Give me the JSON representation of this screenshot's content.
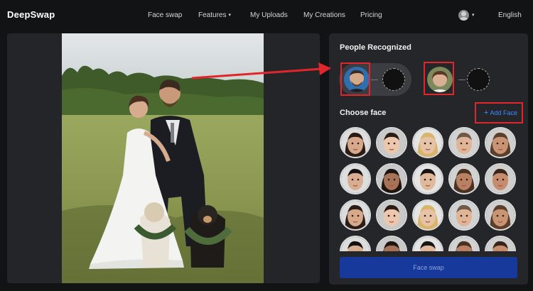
{
  "nav": {
    "logo": "DeepSwap",
    "items": [
      {
        "label": "Face swap"
      },
      {
        "label": "Features",
        "caret": "▾"
      },
      {
        "label": "My Uploads"
      },
      {
        "label": "My Creations"
      },
      {
        "label": "Pricing"
      }
    ],
    "language": "English",
    "language_caret": "▾",
    "user_caret": "▾"
  },
  "panel": {
    "people_title": "People Recognized",
    "choose_title": "Choose face",
    "add_face_icon": "+",
    "add_face_label": "Add Face",
    "swap_button": "Face swap"
  },
  "colors": {
    "accent": "#3d8bff",
    "button": "#17399c",
    "highlight": "#e0262b",
    "panel": "#25262a"
  },
  "face_grid": {
    "rows_visible": 3.3,
    "columns": 5
  }
}
